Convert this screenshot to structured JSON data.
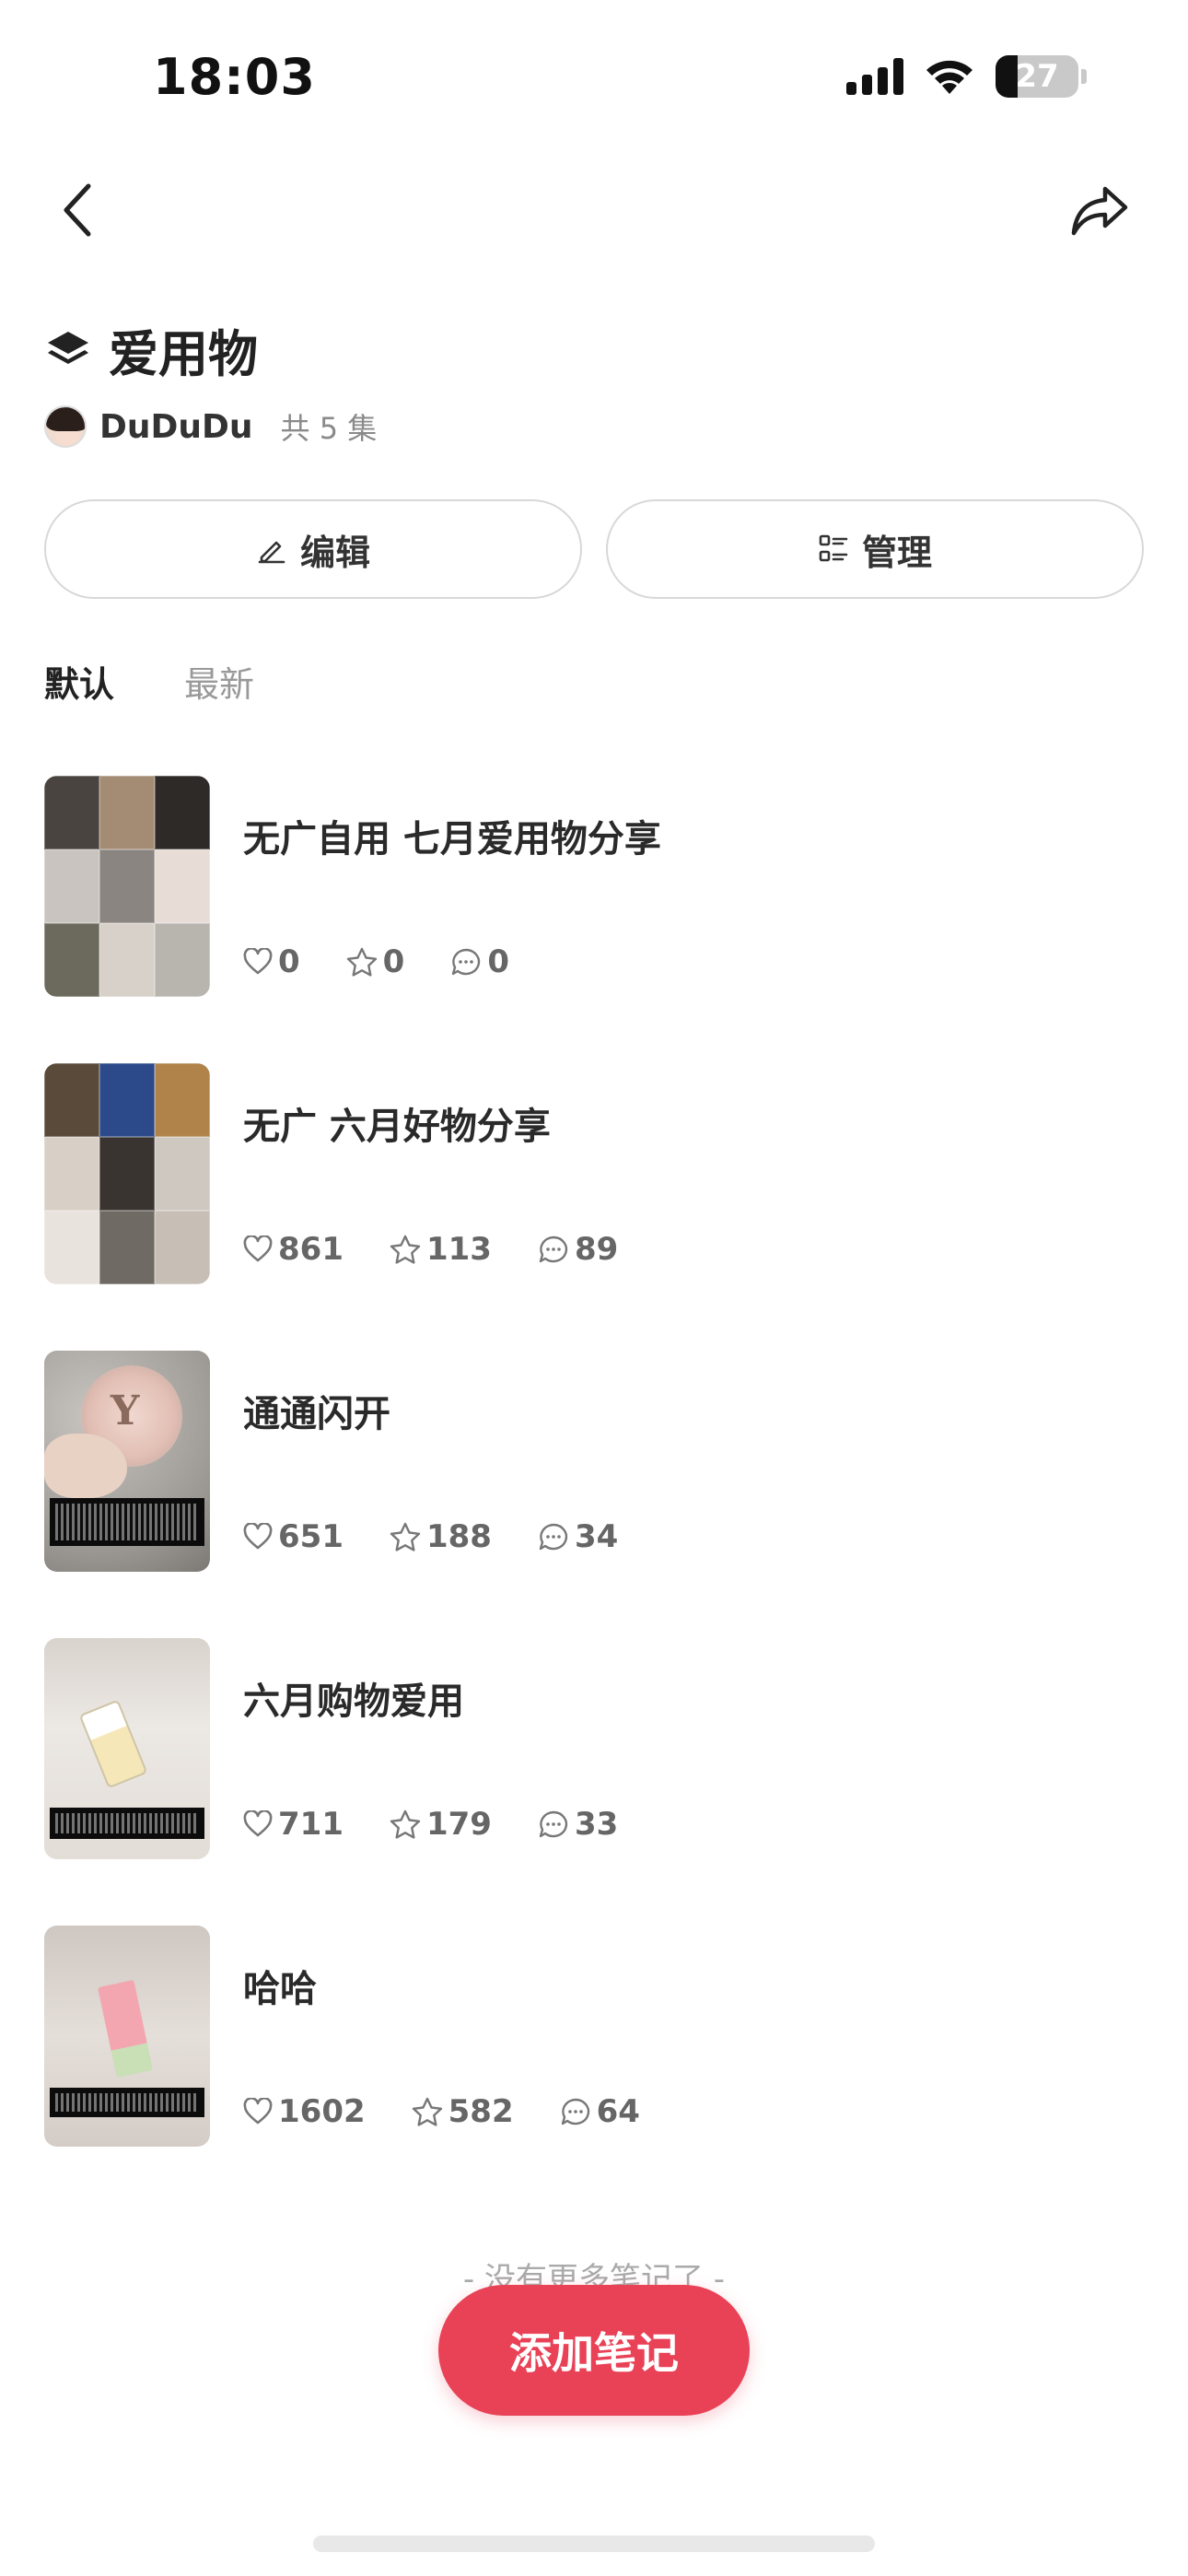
{
  "status_bar": {
    "time": "18:03",
    "battery": "27",
    "battery_level": 0.27
  },
  "nav": {
    "back_icon": "chevron-left-icon",
    "share_icon": "share-arrow-icon"
  },
  "header": {
    "title": "爱用物",
    "title_icon": "layers-icon",
    "author": "DuDuDu",
    "episode_count": "共 5 集"
  },
  "actions": {
    "edit_label": "编辑",
    "manage_label": "管理"
  },
  "tabs": [
    {
      "label": "默认",
      "active": true
    },
    {
      "label": "最新",
      "active": false
    }
  ],
  "notes": [
    {
      "title": "无广自用 七月爱用物分享",
      "likes": "0",
      "stars": "0",
      "comments": "0"
    },
    {
      "title": "无广 六月好物分享",
      "likes": "861",
      "stars": "113",
      "comments": "89"
    },
    {
      "title": "通通闪开",
      "likes": "651",
      "stars": "188",
      "comments": "34"
    },
    {
      "title": "六月购物爱用",
      "likes": "711",
      "stars": "179",
      "comments": "33"
    },
    {
      "title": "哈哈",
      "likes": "1602",
      "stars": "582",
      "comments": "64"
    }
  ],
  "footer": {
    "end_text": "- 没有更多笔记了 -",
    "add_button": "添加笔记"
  },
  "colors": {
    "accent": "#e94156",
    "text_primary": "#222222",
    "text_secondary": "#999999"
  }
}
